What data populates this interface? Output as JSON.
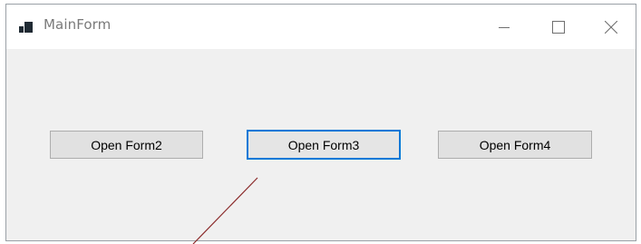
{
  "window": {
    "title": "MainForm",
    "controls": {
      "minimize_icon": "minimize-icon",
      "maximize_icon": "maximize-icon",
      "close_icon": "close-icon"
    }
  },
  "buttons": [
    {
      "label": "Open Form2",
      "focused": false
    },
    {
      "label": "Open Form3",
      "focused": true
    },
    {
      "label": "Open Form4",
      "focused": false
    }
  ],
  "colors": {
    "focus_border": "#0078d7",
    "client_background": "#f0f0f0",
    "button_background": "#e1e1e1",
    "annotation_line": "#8b2a2a"
  }
}
